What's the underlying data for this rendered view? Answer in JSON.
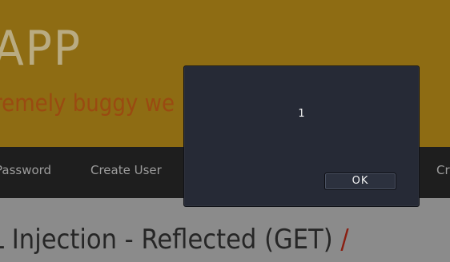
{
  "header": {
    "title": "APP",
    "subtitle": "remely buggy we"
  },
  "menu": {
    "items": [
      {
        "label": "Password"
      },
      {
        "label": "Create User"
      },
      {
        "label": "Cr"
      }
    ]
  },
  "content": {
    "heading": "L Injection - Reflected (GET)",
    "heading_separator": "/"
  },
  "dialog": {
    "message": "1",
    "ok_label": "OK"
  },
  "colors": {
    "header_background": "#8e6c13",
    "menubar_background": "#1e1e1e",
    "dialog_background": "#262a36"
  }
}
